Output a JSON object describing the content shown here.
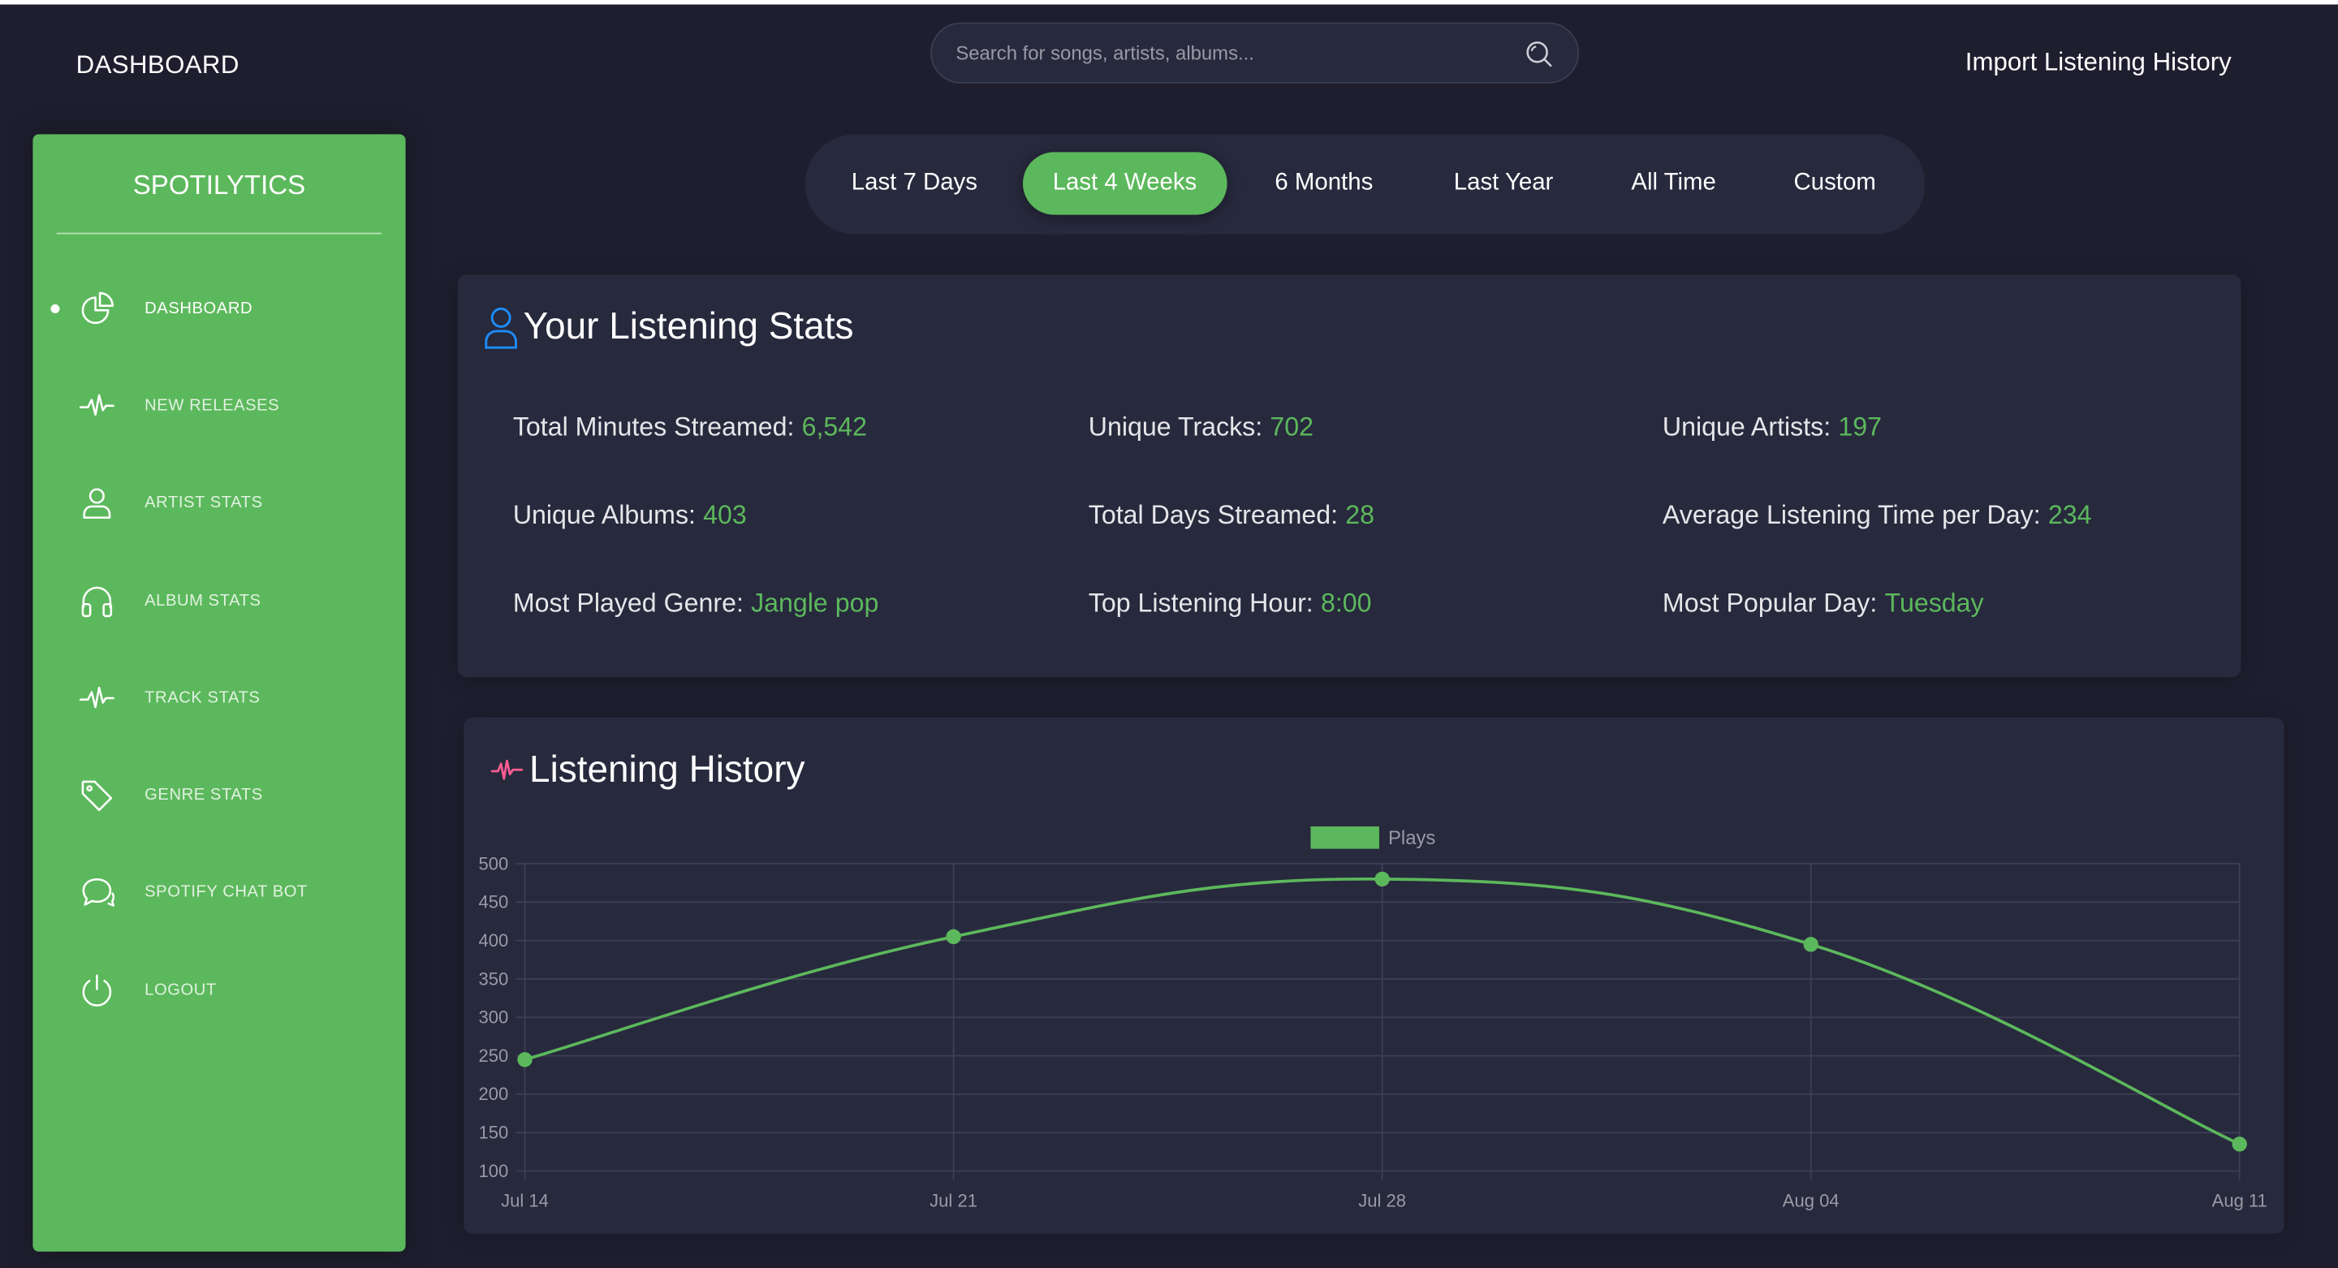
{
  "header": {
    "brand": "DASHBOARD",
    "search_placeholder": "Search for songs, artists, albums...",
    "import_label": "Import Listening History",
    "search_icon": "search-icon"
  },
  "sidebar": {
    "logo": "SPOTILYTICS",
    "items": [
      {
        "label": "DASHBOARD",
        "icon": "pie-chart-icon",
        "active": true
      },
      {
        "label": "NEW RELEASES",
        "icon": "pulse-icon"
      },
      {
        "label": "ARTIST STATS",
        "icon": "user-icon"
      },
      {
        "label": "ALBUM STATS",
        "icon": "headphones-icon"
      },
      {
        "label": "TRACK STATS",
        "icon": "pulse-icon"
      },
      {
        "label": "GENRE STATS",
        "icon": "tag-icon"
      },
      {
        "label": "SPOTIFY CHAT BOT",
        "icon": "chat-icon"
      },
      {
        "label": "LOGOUT",
        "icon": "power-icon"
      }
    ]
  },
  "ranges": {
    "items": [
      "Last 7 Days",
      "Last 4 Weeks",
      "6 Months",
      "Last Year",
      "All Time",
      "Custom"
    ],
    "selected": "Last 4 Weeks"
  },
  "stats": {
    "title": "Your Listening Stats",
    "items": [
      {
        "label": "Total Minutes Streamed:",
        "value": "6,542"
      },
      {
        "label": "Unique Tracks:",
        "value": "702"
      },
      {
        "label": "Unique Artists:",
        "value": "197"
      },
      {
        "label": "Unique Albums:",
        "value": "403"
      },
      {
        "label": "Total Days Streamed:",
        "value": "28"
      },
      {
        "label": "Average Listening Time per Day:",
        "value": "234"
      },
      {
        "label": "Most Played Genre:",
        "value": "Jangle pop"
      },
      {
        "label": "Top Listening Hour:",
        "value": "8:00"
      },
      {
        "label": "Most Popular Day:",
        "value": "Tuesday"
      }
    ]
  },
  "history": {
    "title": "Listening History"
  },
  "colors": {
    "accent": "#5cb85c",
    "background": "#1e1e2f",
    "card": "#27293d",
    "user_icon": "#1d8cf8",
    "pulse_icon": "#fd5d93"
  },
  "chart_data": {
    "type": "line",
    "categories": [
      "Jul 14",
      "Jul 21",
      "Jul 28",
      "Aug 04",
      "Aug 11"
    ],
    "series": [
      {
        "name": "Plays",
        "values": [
          245,
          405,
          480,
          395,
          135
        ]
      }
    ],
    "ylim": [
      100,
      500
    ],
    "yticks": [
      500,
      450,
      400,
      350,
      300,
      250,
      200,
      150,
      100
    ],
    "grid": true,
    "legend": "top-center"
  }
}
